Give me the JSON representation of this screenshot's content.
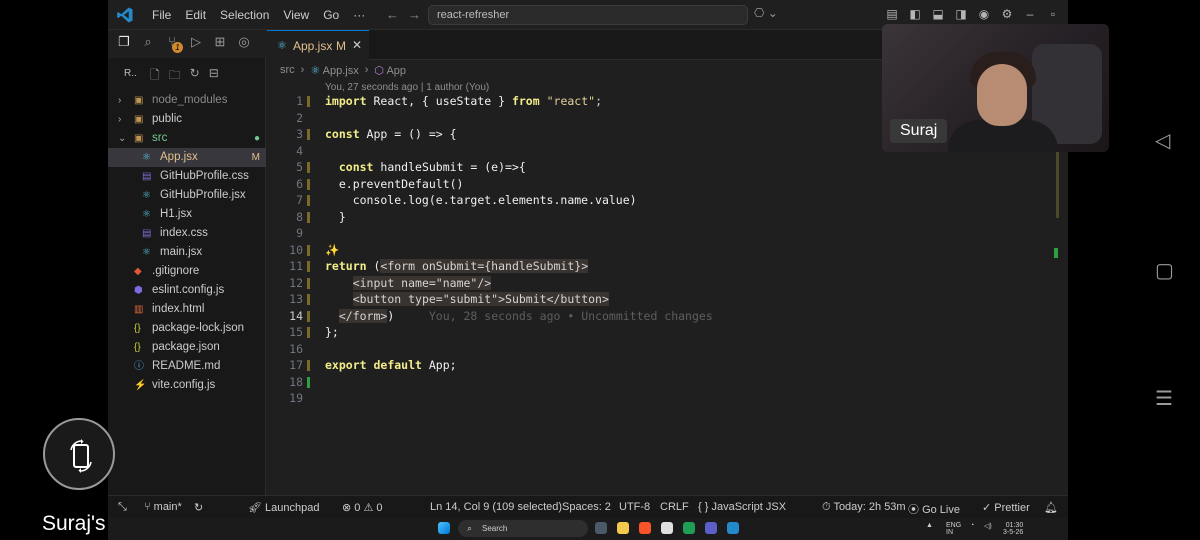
{
  "window": {
    "menu": [
      "File",
      "Edit",
      "Selection",
      "View",
      "Go",
      "···"
    ],
    "command_center": "react-refresher"
  },
  "source_control_badge": "1",
  "explorer": {
    "title_abbrev": "R..",
    "items": [
      {
        "label": "node_modules",
        "type": "folder",
        "state": "collapsed",
        "indent": 0,
        "color": "muted"
      },
      {
        "label": "public",
        "type": "folder",
        "state": "collapsed",
        "indent": 0
      },
      {
        "label": "src",
        "type": "folder",
        "state": "expanded",
        "indent": 0,
        "color": "green",
        "marker": "●"
      },
      {
        "label": "App.jsx",
        "type": "jsx",
        "indent": 1,
        "color": "mod",
        "marker": "M",
        "selected": true
      },
      {
        "label": "GitHubProfile.css",
        "type": "css",
        "indent": 1
      },
      {
        "label": "GitHubProfile.jsx",
        "type": "jsx",
        "indent": 1
      },
      {
        "label": "H1.jsx",
        "type": "jsx",
        "indent": 1
      },
      {
        "label": "index.css",
        "type": "css",
        "indent": 1
      },
      {
        "label": "main.jsx",
        "type": "jsx",
        "indent": 1
      },
      {
        "label": ".gitignore",
        "type": "git",
        "indent": 0
      },
      {
        "label": "eslint.config.js",
        "type": "eslint",
        "indent": 0
      },
      {
        "label": "index.html",
        "type": "html",
        "indent": 0
      },
      {
        "label": "package-lock.json",
        "type": "json",
        "indent": 0
      },
      {
        "label": "package.json",
        "type": "json",
        "indent": 0
      },
      {
        "label": "README.md",
        "type": "md",
        "indent": 0
      },
      {
        "label": "vite.config.js",
        "type": "vite",
        "indent": 0
      }
    ]
  },
  "tab": {
    "label": "App.jsx",
    "marker": "M",
    "close": "✕"
  },
  "breadcrumb": [
    "src",
    "App.jsx",
    "App"
  ],
  "blame_header": "You, 27 seconds ago | 1 author (You)",
  "code": {
    "current_line": 14,
    "inline_blame": "You, 28 seconds ago • Uncommitted changes",
    "lines": [
      [
        [
          "import",
          "kw"
        ],
        [
          " React, { useState } ",
          "var"
        ],
        [
          "from",
          "kw"
        ],
        [
          " ",
          ""
        ],
        [
          "\"react\"",
          "str2"
        ],
        [
          ";",
          ""
        ]
      ],
      [],
      [
        [
          "const",
          "kw"
        ],
        [
          " App = () => {",
          "var"
        ]
      ],
      [],
      [
        [
          "  ",
          ""
        ],
        [
          "const",
          "kw"
        ],
        [
          " handleSubmit = (e)=>{",
          "var"
        ]
      ],
      [
        [
          "  e.preventDefault()",
          "var"
        ]
      ],
      [
        [
          "    console.log(e.target.elements.name.value)",
          "var"
        ]
      ],
      [
        [
          "  }",
          "var"
        ]
      ],
      [],
      [
        [
          "✨",
          "str"
        ]
      ],
      [
        [
          "return",
          "kw"
        ],
        [
          " (",
          "var"
        ],
        [
          "<form onSubmit={handleSubmit}>",
          "hl"
        ]
      ],
      [
        [
          "    ",
          ""
        ],
        [
          "<input name=",
          "hl"
        ],
        [
          "\"name\"",
          "hl"
        ],
        [
          "/>",
          "hl"
        ]
      ],
      [
        [
          "    ",
          ""
        ],
        [
          "<button type=",
          "hl"
        ],
        [
          "\"submit\"",
          "hl"
        ],
        [
          ">Submit</button>",
          "hl"
        ]
      ],
      [
        [
          "  ",
          ""
        ],
        [
          "</form>",
          "hl"
        ],
        [
          ")",
          "var"
        ]
      ],
      [
        [
          "};",
          "var"
        ]
      ],
      [],
      [
        [
          "export",
          "kw"
        ],
        [
          " ",
          ""
        ],
        [
          "default",
          "kw"
        ],
        [
          " App;",
          "var"
        ]
      ],
      [],
      []
    ]
  },
  "status": {
    "branch": "main*",
    "launchpad": "Launchpad",
    "errors": "0",
    "warnings": "0",
    "position": "Ln 14, Col 9 (109 selected)",
    "spaces": "Spaces: 2",
    "encoding": "UTF-8",
    "eol": "CRLF",
    "language": "JavaScript JSX",
    "time": "Today: 2h 53m",
    "golive": "Go Live",
    "prettier": "Prettier"
  },
  "webcam": {
    "name": "Suraj"
  },
  "screen_label": "Suraj's screen",
  "taskbar": {
    "search": "Search",
    "lang": "ENG",
    "region": "IN",
    "clock": "01:30",
    "date": "3-5-26"
  }
}
